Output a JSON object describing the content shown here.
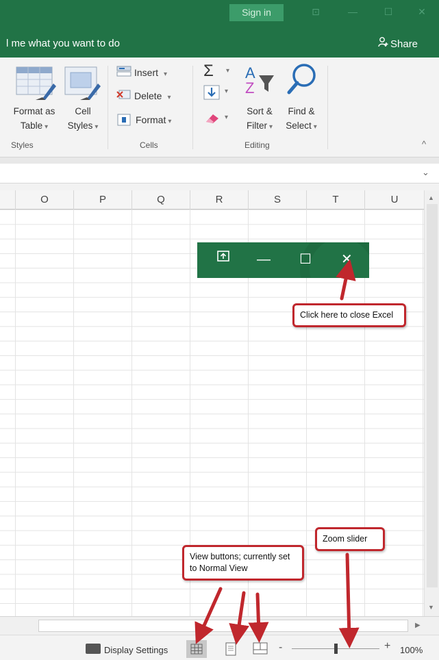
{
  "titlebar": {
    "signin_label": "Sign in",
    "restore_glyph": "⊡",
    "minimize_glyph": "—",
    "maximize_glyph": "☐",
    "close_glyph": "✕"
  },
  "tellbar": {
    "tellme_text": "l me what you want to do",
    "share_label": "Share"
  },
  "ribbon": {
    "styles": {
      "format_as_table_line1": "Format as",
      "format_as_table_line2": "Table",
      "cell_styles_line1": "Cell",
      "cell_styles_line2": "Styles",
      "group_label": "Styles"
    },
    "cells": {
      "insert_label": "Insert",
      "delete_label": "Delete",
      "format_label": "Format",
      "group_label": "Cells"
    },
    "editing": {
      "autosum_glyph": "Σ",
      "sort_filter_line1": "Sort &",
      "sort_filter_line2": "Filter",
      "find_select_line1": "Find &",
      "find_select_line2": "Select",
      "group_label": "Editing"
    },
    "collapse_glyph": "^"
  },
  "columns": [
    "O",
    "P",
    "Q",
    "R",
    "S",
    "T",
    "U"
  ],
  "statusbar": {
    "display_settings_label": "Display Settings",
    "zoom_minus": "-",
    "zoom_plus": "+",
    "zoom_level": "100%",
    "zoom_fraction": 0.5
  },
  "callouts": {
    "close_excel": "Click here to close Excel",
    "view_buttons": "View buttons; currently set to Normal View",
    "zoom_slider": "Zoom slider"
  },
  "colors": {
    "excel_green": "#217346",
    "callout_red": "#c0272d"
  }
}
